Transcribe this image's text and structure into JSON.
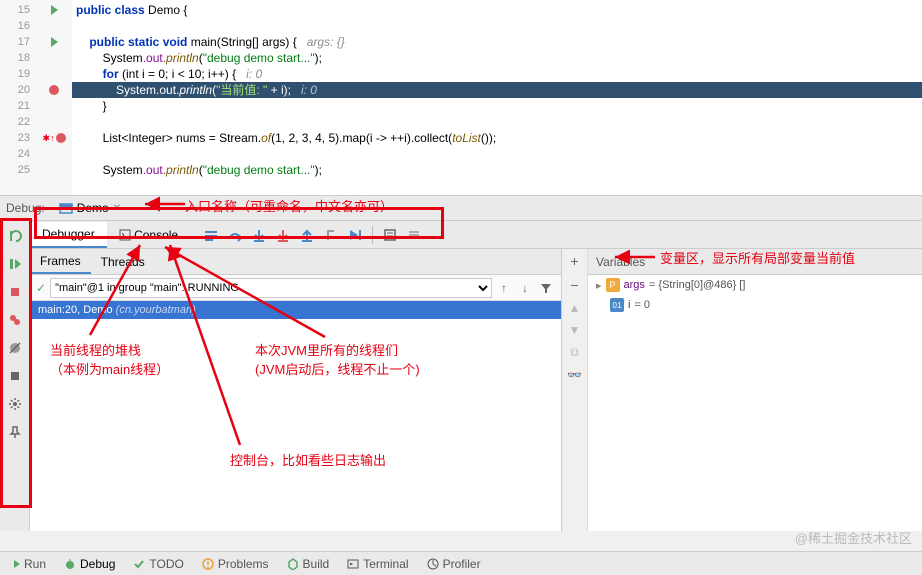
{
  "code": {
    "lines": [
      "15",
      "16",
      "17",
      "18",
      "19",
      "20",
      "21",
      "22",
      "23",
      "24",
      "25"
    ],
    "class_kw": "public class",
    "class_name": "Demo",
    "method_sig1": "public static void",
    "main": "main",
    "main_args": "(String[] args) {",
    "args_comment": "args: {}",
    "sout": "System",
    "out": ".out.",
    "println": "println",
    "str1": "\"debug demo start...\"",
    "for_kw": "for",
    "for_cond": "(int i = 0; i < 10; i++) {",
    "i_comment": "i: 0",
    "str2": "\"当前值: \"",
    "plus_i": " + i);",
    "list_decl": "List<Integer> nums = Stream.",
    "of": "of",
    "of_args": "(1, 2, 3, 4, 5).map(i -> ++i).collect(",
    "tolist": "toList",
    "tolist_end": "());"
  },
  "debug": {
    "label": "Debug:",
    "tab_name": "Demo"
  },
  "tabs": {
    "debugger": "Debugger",
    "console": "Console"
  },
  "frames": {
    "frames_tab": "Frames",
    "threads_tab": "Threads",
    "thread_text": "\"main\"@1 in group \"main\": RUNNING",
    "frame_pre": "main:20, ",
    "frame_class": "Demo",
    "frame_pkg": "(cn.yourbatman)"
  },
  "vars": {
    "title": "Variables",
    "args_name": "args",
    "args_val": " = {String[0]@486} []",
    "i_name": "i",
    "i_val": " = 0"
  },
  "bottom": {
    "run": "Run",
    "debug": "Debug",
    "todo": "TODO",
    "problems": "Problems",
    "build": "Build",
    "terminal": "Terminal",
    "profiler": "Profiler"
  },
  "annotations": {
    "entry": "入口名称（可重命名，中文名亦可）",
    "stack1": "当前线程的堆栈",
    "stack2": "（本例为main线程）",
    "jvm1": "本次JVM里所有的线程们",
    "jvm2": "(JVM启动后，线程不止一个)",
    "console": "控制台，比如看些日志输出",
    "vars": "变量区，显示所有局部变量当前值"
  },
  "watermark": "@稀土掘金技术社区"
}
